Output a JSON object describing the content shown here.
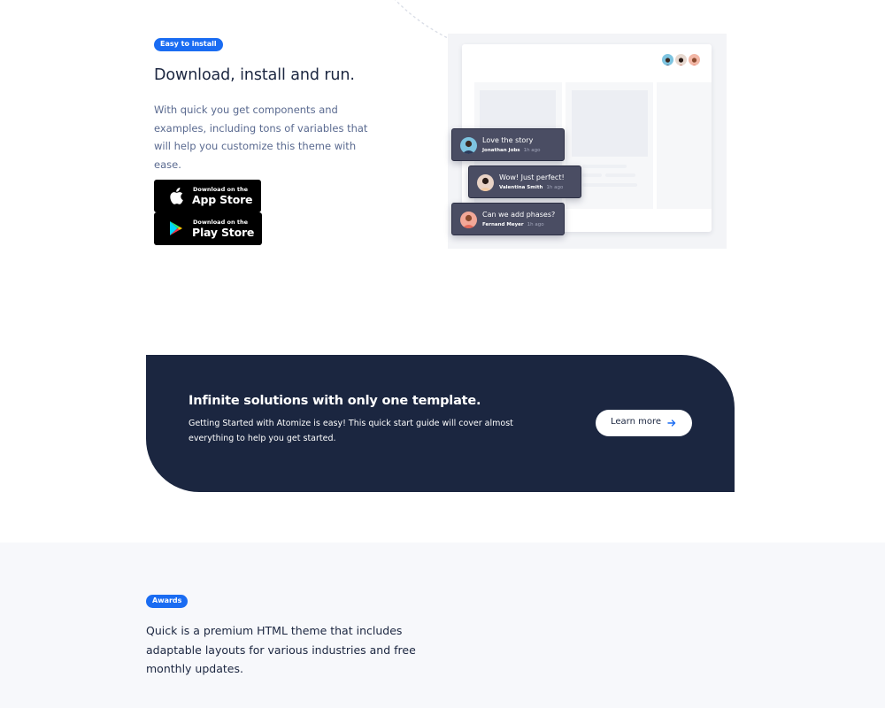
{
  "install": {
    "badge": "Easy to install",
    "title": "Download, install and run.",
    "description": "With quick you get components and examples, including tons of variables that will help you customize this theme with ease.",
    "app_store": {
      "small": "Download on the",
      "big": "App Store"
    },
    "play_store": {
      "small": "Download on the",
      "big": "Play Store"
    }
  },
  "mockup": {
    "avatars": [
      "avatar-blue",
      "avatar-dark",
      "avatar-pink"
    ],
    "comments": [
      {
        "message": "Love the story",
        "author": "Jonathan Jobs",
        "time": "1h ago"
      },
      {
        "message": "Wow! Just perfect!",
        "author": "Valentina Smith",
        "time": "1h ago"
      },
      {
        "message": "Can we add phases?",
        "author": "Fernand Meyer",
        "time": "1h ago"
      }
    ]
  },
  "cta": {
    "title": "Infinite solutions with only one template.",
    "text": "Getting Started with Atomize is easy! This quick start guide will cover almost everything to help you get started.",
    "button": "Learn more"
  },
  "awards": {
    "badge": "Awards",
    "text": "Quick is a premium HTML theme that includes adaptable layouts for various industries and free monthly updates."
  },
  "colors": {
    "accent": "#1a6cf2",
    "navy": "#1b2640",
    "muted": "#5a6a90",
    "chat_bg": "#4a4d63"
  }
}
